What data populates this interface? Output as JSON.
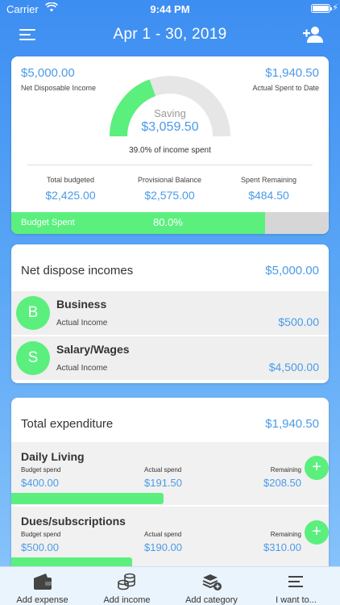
{
  "status": {
    "carrier": "Carrier",
    "time": "9:44 PM"
  },
  "nav": {
    "title": "Apr 1 - 30, 2019"
  },
  "summary": {
    "net_income_value": "$5,000.00",
    "net_income_label": "Net Disposable Income",
    "actual_spent_value": "$1,940.50",
    "actual_spent_label": "Actual Spent to Date",
    "saving_label": "Saving",
    "saving_value": "$3,059.50",
    "percent_spent_text": "39.0% of income spent",
    "percent_spent_fraction": 0.39,
    "total_budgeted_label": "Total budgeted",
    "total_budgeted_value": "$2,425.00",
    "provisional_label": "Provisional Balance",
    "provisional_value": "$2,575.00",
    "spent_remaining_label": "Spent Remaining",
    "spent_remaining_value": "$484.50",
    "budget_spent_label": "Budget Spent",
    "budget_spent_pct_text": "80.0%",
    "budget_spent_fraction": 0.8
  },
  "income": {
    "header_label": "Net dispose incomes",
    "header_value": "$5,000.00",
    "items": [
      {
        "initial": "B",
        "name": "Business",
        "sub": "Actual Income",
        "amount": "$500.00"
      },
      {
        "initial": "S",
        "name": "Salary/Wages",
        "sub": "Actual Income",
        "amount": "$4,500.00"
      }
    ]
  },
  "expenditure": {
    "header_label": "Total expenditure",
    "header_value": "$1,940.50",
    "items": [
      {
        "name": "Daily Living",
        "budget_label": "Budget spend",
        "budget_value": "$400.00",
        "actual_label": "Actual spend",
        "actual_value": "$191.50",
        "remaining_label": "Remaining",
        "remaining_value": "$208.50",
        "bar_fraction": 0.479
      },
      {
        "name": "Dues/subscriptions",
        "budget_label": "Budget spend",
        "budget_value": "$500.00",
        "actual_label": "Actual spend",
        "actual_value": "$190.00",
        "remaining_label": "Remaining",
        "remaining_value": "$310.00",
        "bar_fraction": 0.38
      }
    ]
  },
  "tabs": [
    {
      "label": "Add expense",
      "icon": "wallet-icon"
    },
    {
      "label": "Add income",
      "icon": "coins-icon"
    },
    {
      "label": "Add category",
      "icon": "layers-icon"
    },
    {
      "label": "I want to...",
      "icon": "list-icon"
    }
  ],
  "colors": {
    "accent_blue": "#4a9be8",
    "accent_green": "#5bef7e",
    "track_gray": "#e6e6e6"
  }
}
